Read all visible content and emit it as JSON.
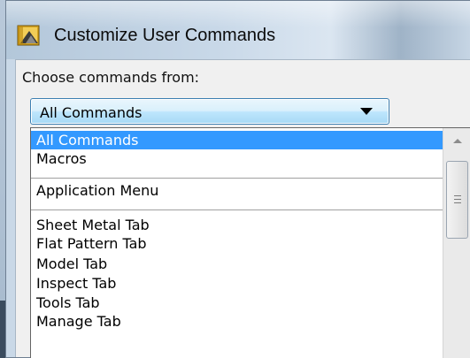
{
  "dialog": {
    "title": "Customize User Commands",
    "icon": "app-icon"
  },
  "choose_label": "Choose commands from:",
  "combo": {
    "value": "All Commands"
  },
  "dropdown": {
    "items": [
      "All Commands",
      "Macros",
      "Application Menu",
      "Sheet Metal Tab",
      "Flat Pattern Tab",
      "Model Tab",
      "Inspect Tab",
      "Tools Tab",
      "Manage Tab"
    ],
    "selected": "All Commands"
  },
  "colors": {
    "selection": "#3399ff",
    "combo_border": "#3c7fb1"
  }
}
